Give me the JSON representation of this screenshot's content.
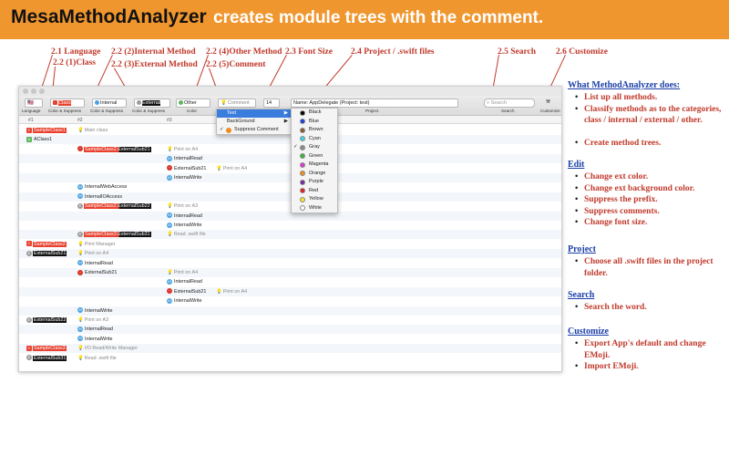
{
  "banner": {
    "title": "MesaMethodAnalyzer",
    "subtitle": "creates module trees with the comment."
  },
  "callouts": {
    "c21": "2.1 Language",
    "c221": "2.2 (1)Class",
    "c222": "2.2 (2)Internal Method",
    "c223": "2.2 (3)External Method",
    "c224": "2.2 (4)Other Method",
    "c225": "2.2 (5)Comment",
    "c23": "2.3 Font Size",
    "c24": "2.4 Project / .swift files",
    "c25": "2.5 Search",
    "c26": "2.6 Customize"
  },
  "toolbar": {
    "language_value": "🇺🇸",
    "class_value": "Class",
    "internal_value": "Internal",
    "external_value": "External",
    "other_value": "Other",
    "comment_value": "Comment",
    "fontsize_value": "14",
    "project_value": "Name: AppDelegate (Project: test)",
    "search_placeholder": "Search",
    "labels": {
      "language": "Language",
      "color_suppress_1": "Color & Suppress",
      "color_suppress_2": "Color & Suppress",
      "color_suppress_3": "Color & Suppress",
      "color": "Color",
      "project": "Project",
      "search": "Search",
      "customize": "Customize"
    }
  },
  "columns": [
    "#1",
    "#2",
    "#3"
  ],
  "tree": [
    {
      "col": 0,
      "icon": "redsq",
      "label": "SampleClass1",
      "style": "red",
      "comment": "Main class",
      "ccol": 1
    },
    {
      "col": 0,
      "icon": "green",
      "label": "AClass1",
      "style": "",
      "comment": "",
      "ccol": 0
    },
    {
      "col": 1,
      "icon": "redc",
      "label": "SampleClass2.ExternalSub21",
      "style": "redblack",
      "comment": "Print on A4",
      "ccol": 2
    },
    {
      "col": 2,
      "icon": "blue",
      "label": "InternalRead",
      "style": "",
      "comment": "",
      "ccol": 0
    },
    {
      "col": 2,
      "icon": "redc",
      "label": "ExternalSub21",
      "style": "",
      "comment": "Print on A4",
      "ccol": 3
    },
    {
      "col": 2,
      "icon": "blue",
      "label": "InternalWrite",
      "style": "",
      "comment": "",
      "ccol": 0
    },
    {
      "col": 1,
      "icon": "blue",
      "label": "InternalWebAccess",
      "style": "",
      "comment": "",
      "ccol": 0
    },
    {
      "col": 1,
      "icon": "blue",
      "label": "InternalIOAccess",
      "style": "",
      "comment": "",
      "ccol": 0
    },
    {
      "col": 1,
      "icon": "gray",
      "label": "SampleClass2.ExternalSub22",
      "style": "redblack",
      "comment": "Print on A3",
      "ccol": 2
    },
    {
      "col": 2,
      "icon": "blue",
      "label": "InternalRead",
      "style": "",
      "comment": "",
      "ccol": 0
    },
    {
      "col": 2,
      "icon": "blue",
      "label": "InternalWrite",
      "style": "",
      "comment": "",
      "ccol": 0
    },
    {
      "col": 1,
      "icon": "gray",
      "label": "SampleClass3.ExternalSub31",
      "style": "redblack",
      "comment": "Read .swift file",
      "ccol": 2
    },
    {
      "col": 0,
      "icon": "redsq",
      "label": "SampleClass2",
      "style": "red",
      "comment": "Print Manager",
      "ccol": 1
    },
    {
      "col": 0,
      "icon": "gray",
      "label": "ExternalSub21",
      "style": "black",
      "comment": "Print on A4",
      "ccol": 1
    },
    {
      "col": 1,
      "icon": "blue",
      "label": "InternalRead",
      "style": "",
      "comment": "",
      "ccol": 0
    },
    {
      "col": 1,
      "icon": "redc",
      "label": "ExternalSub21",
      "style": "",
      "comment": "Print on A4",
      "ccol": 2
    },
    {
      "col": 2,
      "icon": "blue",
      "label": "InternalRead",
      "style": "",
      "comment": "",
      "ccol": 0
    },
    {
      "col": 2,
      "icon": "redc",
      "label": "ExternalSub21",
      "style": "",
      "comment": "Print on A4",
      "ccol": 3
    },
    {
      "col": 2,
      "icon": "blue",
      "label": "InternalWrite",
      "style": "",
      "comment": "",
      "ccol": 0
    },
    {
      "col": 1,
      "icon": "blue",
      "label": "InternalWrite",
      "style": "",
      "comment": "",
      "ccol": 0
    },
    {
      "col": 0,
      "icon": "gray",
      "label": "ExternalSub22",
      "style": "black",
      "comment": "Print on A3",
      "ccol": 1
    },
    {
      "col": 1,
      "icon": "blue",
      "label": "InternalRead",
      "style": "",
      "comment": "",
      "ccol": 0
    },
    {
      "col": 1,
      "icon": "blue",
      "label": "InternalWrite",
      "style": "",
      "comment": "",
      "ccol": 0
    },
    {
      "col": 0,
      "icon": "redsq",
      "label": "SampleClass3",
      "style": "red",
      "comment": "I/O Read/Write Manager",
      "ccol": 1
    },
    {
      "col": 0,
      "icon": "gray",
      "label": "ExternalSub31",
      "style": "black",
      "comment": "Read .swift file",
      "ccol": 1
    }
  ],
  "comment_menu": {
    "items": [
      "Text",
      "BackGround",
      "Suppress Comment"
    ],
    "suppress_checked": "✓"
  },
  "color_menu": {
    "items": [
      {
        "name": "Black",
        "color": "#000000"
      },
      {
        "name": "Blue",
        "color": "#1e40d8"
      },
      {
        "name": "Brown",
        "color": "#8b5a2b"
      },
      {
        "name": "Cyan",
        "color": "#3fd4e8"
      },
      {
        "name": "Gray",
        "color": "#8c8c8c"
      },
      {
        "name": "Green",
        "color": "#35b535"
      },
      {
        "name": "Magenta",
        "color": "#d63cd6"
      },
      {
        "name": "Orange",
        "color": "#f08c1e"
      },
      {
        "name": "Purple",
        "color": "#7a2aa0"
      },
      {
        "name": "Red",
        "color": "#e02020"
      },
      {
        "name": "Yellow",
        "color": "#f2e526"
      },
      {
        "name": "White",
        "color": "#ffffff"
      }
    ],
    "checked": "Gray"
  },
  "right_panel": {
    "sections": [
      {
        "heading": "What MethodAnalyzer does:",
        "bullets": [
          "List up all methods.",
          "Classify methods as to the categories, class / internal / external / other.",
          "Create method trees."
        ]
      },
      {
        "heading": "Edit",
        "bullets": [
          "Change ext color.",
          "Change ext background color.",
          "Suppress the prefix.",
          "Suppress comments.",
          "Change font size."
        ]
      },
      {
        "heading": "Project",
        "bullets": [
          "Choose all .swift files in the project folder."
        ]
      },
      {
        "heading": "Search",
        "bullets": [
          "Search the word."
        ]
      },
      {
        "heading": "Customize",
        "bullets": [
          "Export App's default and change EMoji.",
          "Import EMoji."
        ]
      }
    ]
  },
  "colors": {
    "banner": "#f0962e",
    "callout": "#c0392b",
    "heading": "#1a3ea8",
    "class_highlight": "#e8412f"
  }
}
